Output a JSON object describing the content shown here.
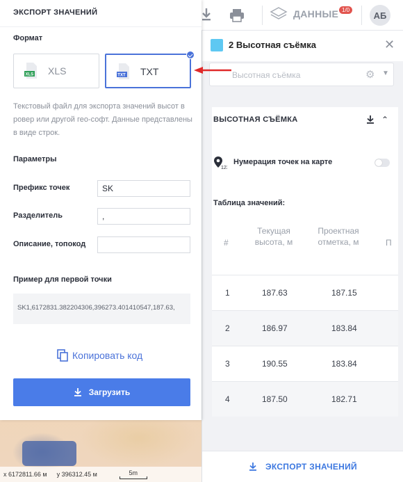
{
  "export_dialog": {
    "title": "ЭКСПОРТ ЗНАЧЕНИЙ",
    "format_label": "Формат",
    "formats": [
      {
        "label": "XLS",
        "icon": "xls-file-icon",
        "selected": false
      },
      {
        "label": "TXT",
        "icon": "txt-file-icon",
        "selected": true
      }
    ],
    "description": "Текстовый файл для экспорта значений высот в ровер или другой гео-софт. Данные представлены в виде строк.",
    "params_label": "Параметры",
    "fields": [
      {
        "label": "Префикс точек",
        "value": "SK"
      },
      {
        "label": "Разделитель",
        "value": ","
      },
      {
        "label": "Описание, топокод",
        "value": ""
      }
    ],
    "example_label": "Пример для первой точки",
    "example_value": "SK1,6172831.382204306,396273.401410547,187.63,",
    "copy_label": "Копировать код",
    "download_label": "Загрузить"
  },
  "toolbar": {
    "data_label": "ДАННЫЕ",
    "data_badge": "1/0",
    "avatar_initials": "АБ"
  },
  "layer_panel": {
    "title": "2 Высотная съёмка",
    "layer_color": "#5ec8f2",
    "select_placeholder": "Высотная съёмка",
    "section_title": "ВЫСОТНАЯ СЪЁМКА",
    "numbering_label": "Нумерация точек на карте",
    "numbering_enabled": false,
    "table_label": "Таблица значений:",
    "columns": [
      "#",
      "Текущая высота, м",
      "Проектная отметка, м",
      "П"
    ],
    "rows": [
      {
        "n": "1",
        "current": "187.63",
        "design": "187.15"
      },
      {
        "n": "2",
        "current": "186.97",
        "design": "183.84"
      },
      {
        "n": "3",
        "current": "190.55",
        "design": "183.84"
      },
      {
        "n": "4",
        "current": "187.50",
        "design": "182.71"
      }
    ],
    "footer_label": "ЭКСПОРТ ЗНАЧЕНИЙ"
  },
  "map": {
    "coord_x": "x 6172811.66 м",
    "coord_y": "y 396312.45 м",
    "scale_label": "5m"
  },
  "colors": {
    "accent": "#4a7ce8",
    "selected_border": "#4a72d9",
    "badge": "#e2554f",
    "arrow": "#e02a2a"
  }
}
